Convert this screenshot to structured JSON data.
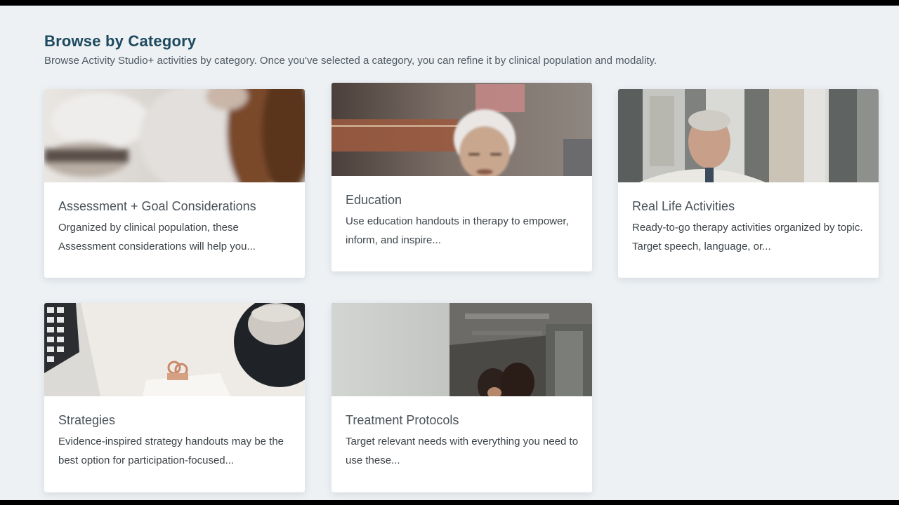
{
  "header": {
    "title": "Browse by Category",
    "subtitle": "Browse Activity Studio+ activities by category. Once you've selected a category, you can refine it by clinical population and modality."
  },
  "cards": [
    {
      "title": "Assessment + Goal Considerations",
      "description": "Organized by clinical population, these Assessment considerations will help you...",
      "image": "person-with-long-hair-photo"
    },
    {
      "title": "Education",
      "description": "Use education handouts in therapy to empower, inform, and inspire...",
      "image": "elderly-woman-photo"
    },
    {
      "title": "Real Life Activities",
      "description": "Ready-to-go therapy activities organized by topic. Target speech, language, or...",
      "image": "older-man-office-photo"
    },
    {
      "title": "Strategies",
      "description": "Evidence-inspired strategy handouts may be the best option for participation-focused...",
      "image": "desk-laptop-clipboard-photo"
    },
    {
      "title": "Treatment Protocols",
      "description": "Target relevant needs with everything you need to use these...",
      "image": "office-team-photo"
    }
  ],
  "colors": {
    "title": "#1d4a5e",
    "background": "#edf1f4",
    "card": "#ffffff",
    "frame": "#000000"
  }
}
